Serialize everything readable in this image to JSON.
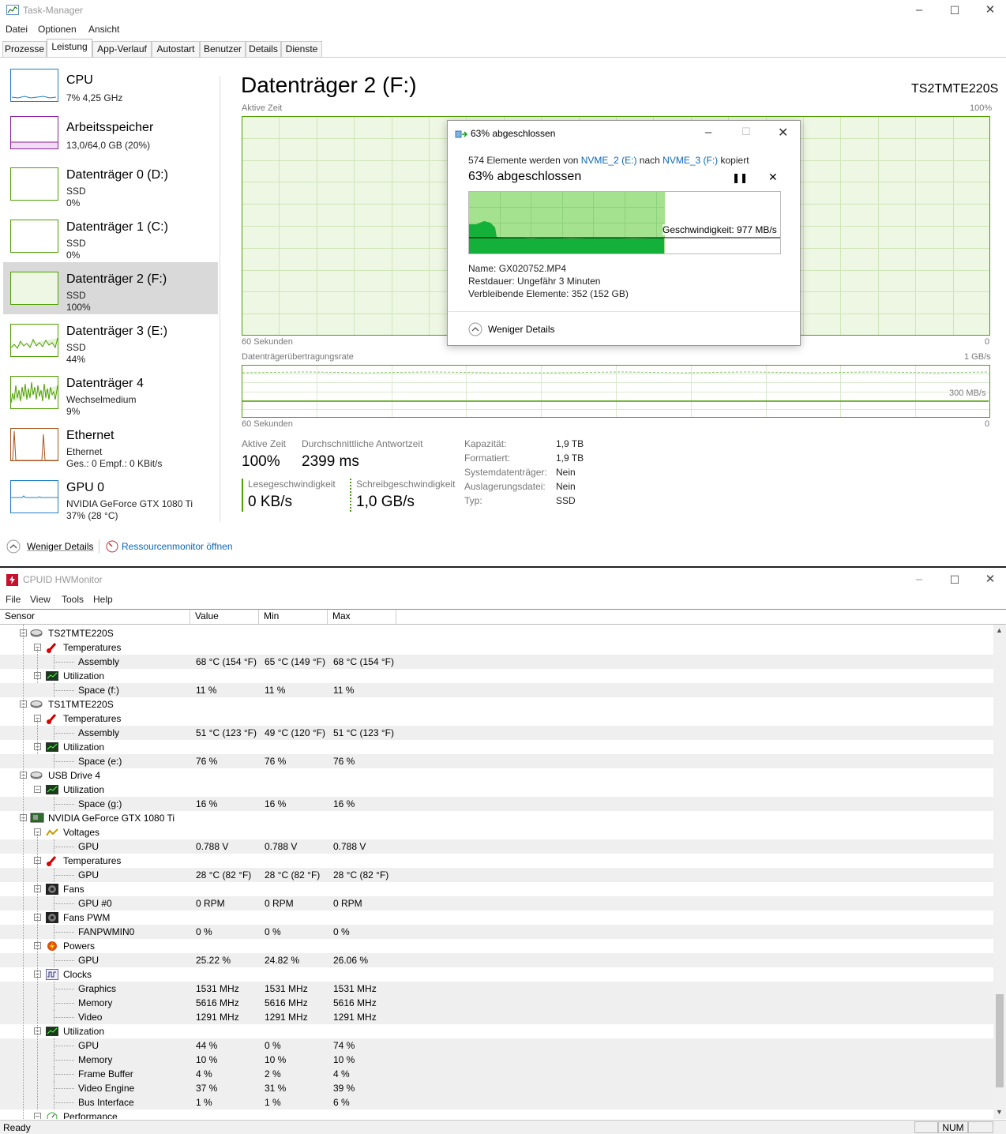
{
  "tm": {
    "title": "Task-Manager",
    "menu": [
      "Datei",
      "Optionen",
      "Ansicht"
    ],
    "tabs": [
      "Prozesse",
      "Leistung",
      "App-Verlauf",
      "Autostart",
      "Benutzer",
      "Details",
      "Dienste"
    ],
    "sidebar": [
      {
        "name": "CPU",
        "sub1": "7% 4,25 GHz",
        "sub2": "",
        "color": "#1f7fc4"
      },
      {
        "name": "Arbeitsspeicher",
        "sub1": "13,0/64,0 GB (20%)",
        "sub2": "",
        "color": "#8b1f9b"
      },
      {
        "name": "Datenträger 0 (D:)",
        "sub1": "SSD",
        "sub2": "0%",
        "color": "#4da000"
      },
      {
        "name": "Datenträger 1 (C:)",
        "sub1": "SSD",
        "sub2": "0%",
        "color": "#4da000"
      },
      {
        "name": "Datenträger 2 (F:)",
        "sub1": "SSD",
        "sub2": "100%",
        "color": "#4da000"
      },
      {
        "name": "Datenträger 3 (E:)",
        "sub1": "SSD",
        "sub2": "44%",
        "color": "#4da000"
      },
      {
        "name": "Datenträger 4",
        "sub1": "Wechselmedium",
        "sub2": "9%",
        "color": "#4da000"
      },
      {
        "name": "Ethernet",
        "sub1": "Ethernet",
        "sub2": "Ges.: 0 Empf.: 0 KBit/s",
        "color": "#a8541b"
      },
      {
        "name": "GPU 0",
        "sub1": "NVIDIA GeForce GTX 1080 Ti",
        "sub2": "37% (28 °C)",
        "color": "#1f7fc4"
      }
    ],
    "main": {
      "title": "Datenträger 2 (F:)",
      "model": "TS2TMTE220S",
      "active_time_label": "Aktive Zeit",
      "pct100": "100%",
      "sec60a": "60 Sekunden",
      "zero_a": "0",
      "rate_label": "Datenträgerübertragungsrate",
      "rate_max": "1 GB/s",
      "rate_mid": "300 MB/s",
      "sec60b": "60 Sekunden",
      "zero_b": "0",
      "stat_active_label": "Aktive Zeit",
      "stat_active_value": "100%",
      "stat_resp_label": "Durchschnittliche Antwortzeit",
      "stat_resp_value": "2399 ms",
      "stat_read_label": "Lesegeschwindigkeit",
      "stat_read_value": "0 KB/s",
      "stat_write_label": "Schreibgeschwindigkeit",
      "stat_write_value": "1,0 GB/s",
      "props": [
        {
          "k": "Kapazität:",
          "v": "1,9 TB"
        },
        {
          "k": "Formatiert:",
          "v": "1,9 TB"
        },
        {
          "k": "Systemdatenträger:",
          "v": "Nein"
        },
        {
          "k": "Auslagerungsdatei:",
          "v": "Nein"
        },
        {
          "k": "Typ:",
          "v": "SSD"
        }
      ]
    },
    "footer": {
      "less": "Weniger Details",
      "resmon": "Ressourcenmonitor öffnen"
    }
  },
  "dialog": {
    "title": "63% abgeschlossen",
    "line_pre": "574 Elemente werden von ",
    "src": "NVME_2 (E:)",
    "mid": " nach ",
    "dst": "NVME_3 (F:)",
    "post": " kopiert",
    "heading": "63% abgeschlossen",
    "progress": 0.63,
    "speed": "Geschwindigkeit: 977 MB/s",
    "name_label": "Name:",
    "name_value": "GX020752.MP4",
    "rest_label": "Restdauer:",
    "rest_value": "Ungefähr 3 Minuten",
    "remain_label": "Verbleibende Elemente:",
    "remain_value": "352 (152 GB)",
    "less": "Weniger Details"
  },
  "hw": {
    "title": "CPUID HWMonitor",
    "menu": [
      "File",
      "View",
      "Tools",
      "Help"
    ],
    "cols": [
      "Sensor",
      "Value",
      "Min",
      "Max"
    ],
    "rows": [
      {
        "lvl": 0,
        "t": "TS2TMTE220S",
        "icon": "disk",
        "v": "",
        "mn": "",
        "mx": ""
      },
      {
        "lvl": 1,
        "t": "Temperatures",
        "icon": "temp",
        "v": "",
        "mn": "",
        "mx": ""
      },
      {
        "lvl": 2,
        "t": "Assembly",
        "v": "68 °C  (154 °F)",
        "mn": "65 °C  (149 °F)",
        "mx": "68 °C  (154 °F)"
      },
      {
        "lvl": 1,
        "t": "Utilization",
        "icon": "util",
        "v": "",
        "mn": "",
        "mx": ""
      },
      {
        "lvl": 2,
        "t": "Space (f:)",
        "v": "11 %",
        "mn": "11 %",
        "mx": "11 %"
      },
      {
        "lvl": 0,
        "t": "TS1TMTE220S",
        "icon": "disk",
        "v": "",
        "mn": "",
        "mx": ""
      },
      {
        "lvl": 1,
        "t": "Temperatures",
        "icon": "temp",
        "v": "",
        "mn": "",
        "mx": ""
      },
      {
        "lvl": 2,
        "t": "Assembly",
        "v": "51 °C  (123 °F)",
        "mn": "49 °C  (120 °F)",
        "mx": "51 °C  (123 °F)"
      },
      {
        "lvl": 1,
        "t": "Utilization",
        "icon": "util",
        "v": "",
        "mn": "",
        "mx": ""
      },
      {
        "lvl": 2,
        "t": "Space (e:)",
        "v": "76 %",
        "mn": "76 %",
        "mx": "76 %"
      },
      {
        "lvl": 0,
        "t": "USB Drive 4",
        "icon": "disk",
        "v": "",
        "mn": "",
        "mx": ""
      },
      {
        "lvl": 1,
        "t": "Utilization",
        "icon": "util",
        "v": "",
        "mn": "",
        "mx": ""
      },
      {
        "lvl": 2,
        "t": "Space (g:)",
        "v": "16 %",
        "mn": "16 %",
        "mx": "16 %"
      },
      {
        "lvl": 0,
        "t": "NVIDIA GeForce GTX 1080 Ti",
        "icon": "gpu",
        "v": "",
        "mn": "",
        "mx": ""
      },
      {
        "lvl": 1,
        "t": "Voltages",
        "icon": "volt",
        "v": "",
        "mn": "",
        "mx": ""
      },
      {
        "lvl": 2,
        "t": "GPU",
        "v": "0.788 V",
        "mn": "0.788 V",
        "mx": "0.788 V"
      },
      {
        "lvl": 1,
        "t": "Temperatures",
        "icon": "temp",
        "v": "",
        "mn": "",
        "mx": ""
      },
      {
        "lvl": 2,
        "t": "GPU",
        "v": "28 °C  (82 °F)",
        "mn": "28 °C  (82 °F)",
        "mx": "28 °C  (82 °F)"
      },
      {
        "lvl": 1,
        "t": "Fans",
        "icon": "fan",
        "v": "",
        "mn": "",
        "mx": ""
      },
      {
        "lvl": 2,
        "t": "GPU #0",
        "v": "0 RPM",
        "mn": "0 RPM",
        "mx": "0 RPM"
      },
      {
        "lvl": 1,
        "t": "Fans PWM",
        "icon": "fan",
        "v": "",
        "mn": "",
        "mx": ""
      },
      {
        "lvl": 2,
        "t": "FANPWMIN0",
        "v": "0 %",
        "mn": "0 %",
        "mx": "0 %"
      },
      {
        "lvl": 1,
        "t": "Powers",
        "icon": "power",
        "v": "",
        "mn": "",
        "mx": ""
      },
      {
        "lvl": 2,
        "t": "GPU",
        "v": "25.22 %",
        "mn": "24.82 %",
        "mx": "26.06 %"
      },
      {
        "lvl": 1,
        "t": "Clocks",
        "icon": "clock",
        "v": "",
        "mn": "",
        "mx": ""
      },
      {
        "lvl": 2,
        "t": "Graphics",
        "v": "1531 MHz",
        "mn": "1531 MHz",
        "mx": "1531 MHz"
      },
      {
        "lvl": 2,
        "t": "Memory",
        "v": "5616 MHz",
        "mn": "5616 MHz",
        "mx": "5616 MHz"
      },
      {
        "lvl": 2,
        "t": "Video",
        "v": "1291 MHz",
        "mn": "1291 MHz",
        "mx": "1291 MHz"
      },
      {
        "lvl": 1,
        "t": "Utilization",
        "icon": "util",
        "v": "",
        "mn": "",
        "mx": ""
      },
      {
        "lvl": 2,
        "t": "GPU",
        "v": "44 %",
        "mn": "0 %",
        "mx": "74 %"
      },
      {
        "lvl": 2,
        "t": "Memory",
        "v": "10 %",
        "mn": "10 %",
        "mx": "10 %"
      },
      {
        "lvl": 2,
        "t": "Frame Buffer",
        "v": "4 %",
        "mn": "2 %",
        "mx": "4 %"
      },
      {
        "lvl": 2,
        "t": "Video Engine",
        "v": "37 %",
        "mn": "31 %",
        "mx": "39 %"
      },
      {
        "lvl": 2,
        "t": "Bus Interface",
        "v": "1 %",
        "mn": "1 %",
        "mx": "6 %"
      },
      {
        "lvl": 1,
        "t": "Performance",
        "icon": "perf",
        "v": "",
        "mn": "",
        "mx": ""
      }
    ],
    "status": "Ready",
    "num": "NUM"
  }
}
